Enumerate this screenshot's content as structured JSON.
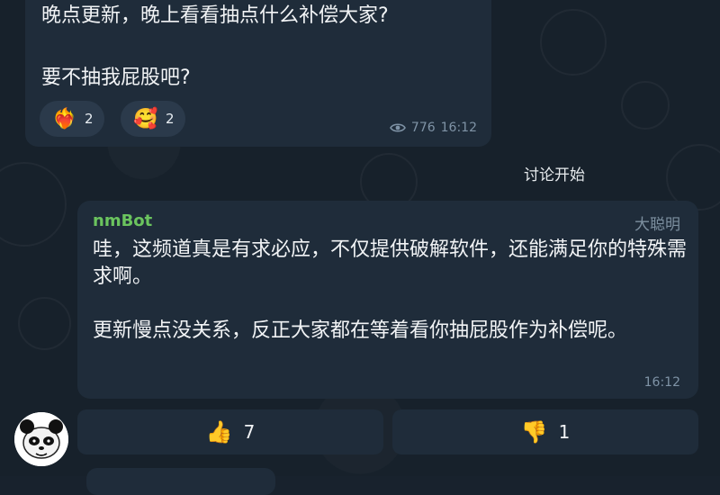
{
  "channel_post": {
    "line1": "晚点更新，晚上看看抽点什么补偿大家?",
    "line2": "要不抽我屁股吧?",
    "reactions": [
      {
        "emoji": "❤️‍🔥",
        "icon": "heart-on-fire-icon",
        "count": "2"
      },
      {
        "emoji": "🥰",
        "icon": "smiling-face-with-hearts-icon",
        "count": "2"
      }
    ],
    "views": "776",
    "time": "16:12"
  },
  "service_message": "讨论开始",
  "bot_message": {
    "sender": "nmBot",
    "tag": "大聪明",
    "paragraph1": "哇，这频道真是有求必应，不仅提供破解软件，还能满足你的特殊需求啊。",
    "paragraph2": "更新慢点没关系，反正大家都在等着看你抽屁股作为补偿呢。",
    "time": "16:12"
  },
  "votes": {
    "up": {
      "emoji": "👍",
      "count": "7"
    },
    "down": {
      "emoji": "👎",
      "count": "1"
    }
  },
  "colors": {
    "background": "#17212b",
    "bubble": "#1f2c3a",
    "sender_name": "#6bc45e",
    "meta": "#7f93a6"
  }
}
